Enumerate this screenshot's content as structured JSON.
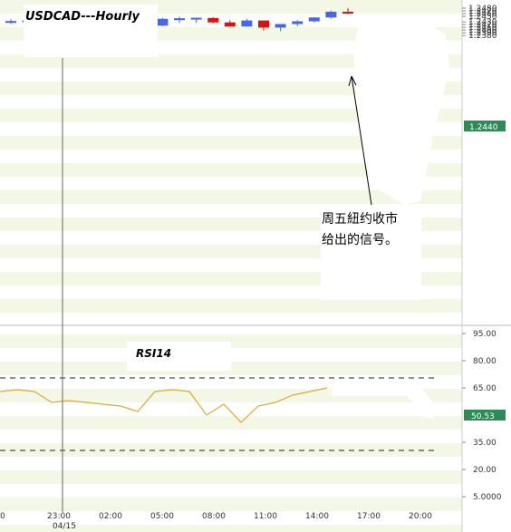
{
  "chart_data": [
    {
      "type": "candlestick",
      "title": "USDCAD---Hourly",
      "ylim": [
        1.2375,
        1.2485
      ],
      "y_ticks": [
        "1.2480",
        "1.2470",
        "1.2460",
        "1.2450",
        "1.2430",
        "1.2420",
        "1.2410",
        "1.2400",
        "1.2390",
        "1.2380"
      ],
      "last_price": "1.2440",
      "up_color": "#4466ee",
      "down_color": "#dd1111",
      "candles": [
        {
          "open": 1.2427,
          "high": 1.244,
          "low": 1.2422,
          "close": 1.2433
        },
        {
          "open": 1.2433,
          "high": 1.2439,
          "low": 1.2421,
          "close": 1.2435
        },
        {
          "open": 1.2434,
          "high": 1.2439,
          "low": 1.242,
          "close": 1.243
        },
        {
          "open": 1.2432,
          "high": 1.2436,
          "low": 1.2418,
          "close": 1.2425
        },
        {
          "open": 1.2425,
          "high": 1.2437,
          "low": 1.2421,
          "close": 1.2423
        },
        {
          "open": 1.2426,
          "high": 1.2428,
          "low": 1.242,
          "close": 1.2426
        },
        {
          "open": 1.2426,
          "high": 1.2432,
          "low": 1.2414,
          "close": 1.2422
        },
        {
          "open": 1.2422,
          "high": 1.2438,
          "low": 1.2414,
          "close": 1.2425
        },
        {
          "open": 1.2425,
          "high": 1.2427,
          "low": 1.2413,
          "close": 1.2416
        },
        {
          "open": 1.2416,
          "high": 1.2444,
          "low": 1.2414,
          "close": 1.2441
        },
        {
          "open": 1.244,
          "high": 1.2448,
          "low": 1.2426,
          "close": 1.2443
        },
        {
          "open": 1.2443,
          "high": 1.2444,
          "low": 1.2427,
          "close": 1.2445
        },
        {
          "open": 1.2444,
          "high": 1.2447,
          "low": 1.2425,
          "close": 1.2428
        },
        {
          "open": 1.2428,
          "high": 1.2436,
          "low": 1.2418,
          "close": 1.2413
        },
        {
          "open": 1.2413,
          "high": 1.2441,
          "low": 1.2412,
          "close": 1.2435
        },
        {
          "open": 1.2435,
          "high": 1.2435,
          "low": 1.2398,
          "close": 1.2409
        },
        {
          "open": 1.2409,
          "high": 1.242,
          "low": 1.2396,
          "close": 1.2422
        },
        {
          "open": 1.2422,
          "high": 1.2436,
          "low": 1.2414,
          "close": 1.2432
        },
        {
          "open": 1.2432,
          "high": 1.2446,
          "low": 1.2428,
          "close": 1.2446
        },
        {
          "open": 1.2446,
          "high": 1.2471,
          "low": 1.2442,
          "close": 1.2467
        },
        {
          "open": 1.2467,
          "high": 1.2481,
          "low": 1.2458,
          "close": 1.2466
        }
      ],
      "annotation": "周五紐约收市\n给出的信号。"
    },
    {
      "type": "line",
      "title": "RSI14",
      "ylim": [
        5,
        95
      ],
      "y_ticks": [
        "95.00",
        "80.00",
        "65.00",
        "50.53",
        "35.00",
        "20.00",
        "5.0000"
      ],
      "last_value": "50.53",
      "dashed_levels": [
        70,
        30
      ],
      "line_color": "#ddaa33",
      "values": [
        63,
        64,
        63,
        57,
        58,
        57,
        56,
        55,
        52,
        63,
        64,
        63,
        50,
        56,
        46,
        55,
        57,
        61,
        63,
        65
      ],
      "x_tick_labels": [
        "0",
        "23:00",
        "02:00",
        "05:00",
        "08:00",
        "11:00",
        "14:00",
        "17:00",
        "20:00"
      ],
      "date_label": "04/15"
    }
  ]
}
